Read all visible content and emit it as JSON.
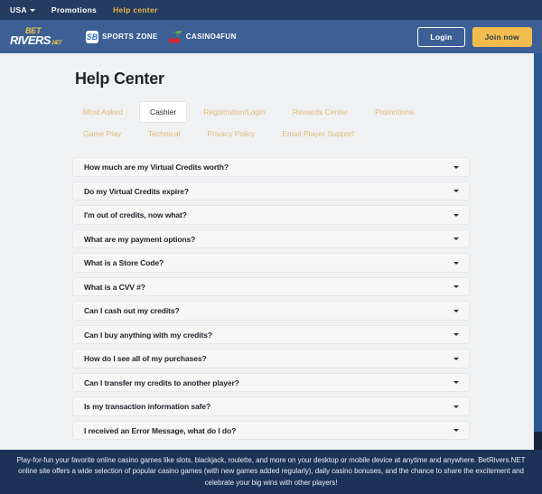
{
  "topbar": {
    "region_label": "USA",
    "region_icon": "chevron-down-icon",
    "promotions_label": "Promotions",
    "help_center_label": "Help center"
  },
  "header": {
    "logo": {
      "bet": "BET",
      "rivers": "RIVERS",
      "net": ".NET"
    },
    "sports_zone_label": "SPORTS ZONE",
    "sports_zone_badge": "SB",
    "casino4fun_label": "CASINO4FUN",
    "login_label": "Login",
    "join_label": "Join now"
  },
  "main": {
    "title": "Help Center",
    "tabs": [
      {
        "label": "Most Asked",
        "active": false
      },
      {
        "label": "Cashier",
        "active": true
      },
      {
        "label": "Registration/Login",
        "active": false
      },
      {
        "label": "Rewards Center",
        "active": false
      },
      {
        "label": "Promotions",
        "active": false
      },
      {
        "label": "Game Play",
        "active": false
      },
      {
        "label": "Technical",
        "active": false
      },
      {
        "label": "Privacy Policy",
        "active": false
      },
      {
        "label": "Email Player Support",
        "active": false
      }
    ],
    "faqs": [
      "How much are my Virtual Credits worth?",
      "Do my Virtual Credits expire?",
      "I'm out of credits, now what?",
      "What are my payment options?",
      "What is a Store Code?",
      "What is a CVV #?",
      "Can I cash out my credits?",
      "Can I buy anything with my credits?",
      "How do I see all of my purchases?",
      "Can I transfer my credits to another player?",
      "Is my transaction information safe?",
      "I received an Error Message, what do I do?"
    ]
  },
  "footer": {
    "text": "Play-for-fun your favorite online casino games like slots, blackjack, roulette, and more on your desktop or mobile device at anytime and anywhere. BetRivers.NET online site offers a wide selection of popular casino games (with new games added regularly), daily casino bonuses, and the chance to share the excitement and celebrate your big wins with other players!"
  },
  "colors": {
    "topbar_bg": "#253c61",
    "header_bg": "#3c6095",
    "content_bg": "#f0f1f3",
    "accent_gold": "#e8b34b",
    "tab_gold": "#dcbb72",
    "join_bg": "#f2bd4f",
    "footer_bg": "#1d3257",
    "scrollbar": "#2a5894"
  }
}
